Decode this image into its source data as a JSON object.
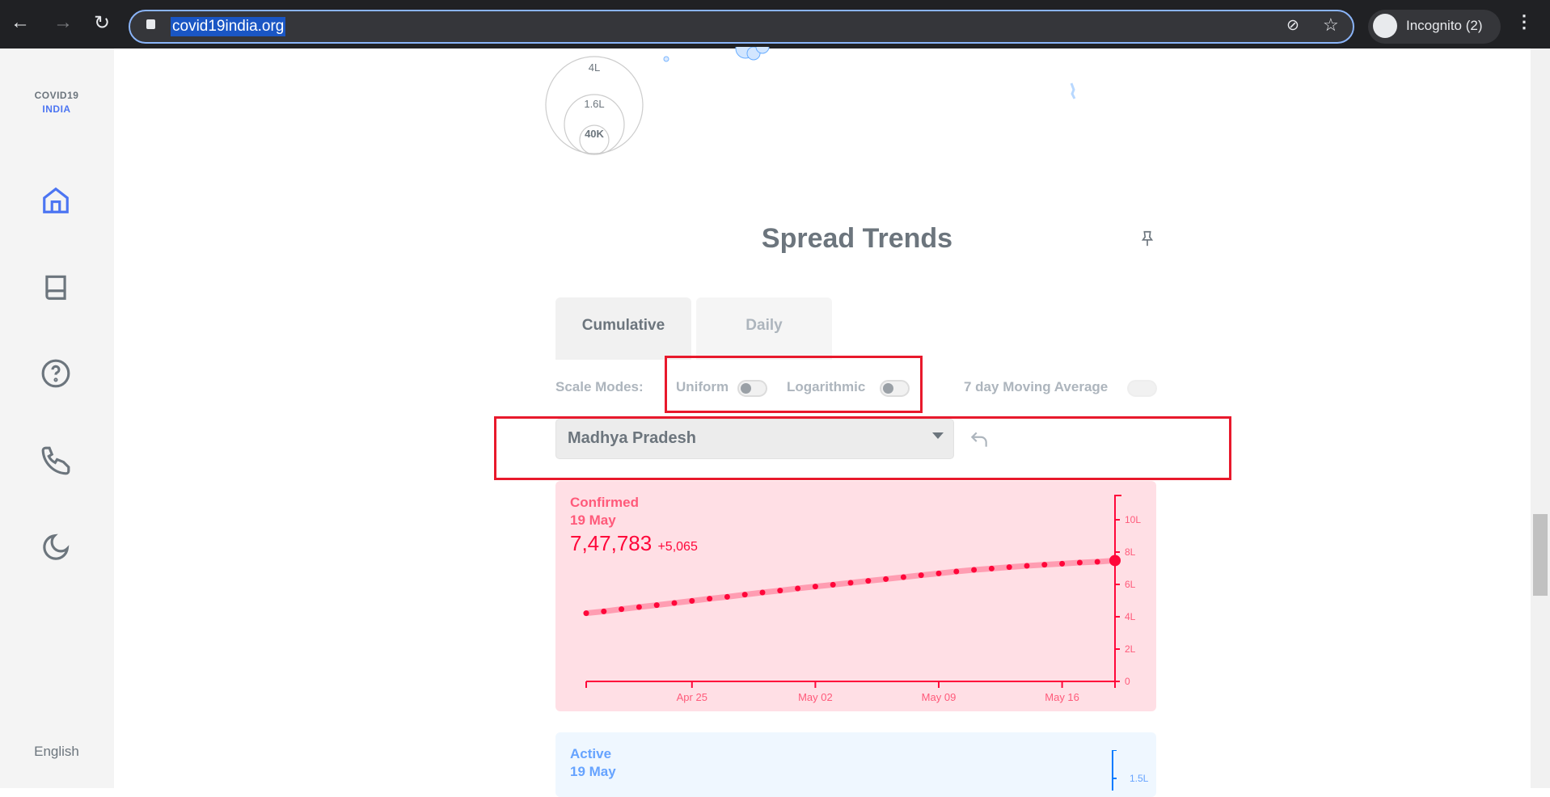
{
  "browser": {
    "url": "covid19india.org",
    "incognito_label": "Incognito (2)"
  },
  "sidebar": {
    "logo_line1": "COVID19",
    "logo_line2": "INDIA",
    "items": [
      {
        "icon": "home-icon"
      },
      {
        "icon": "book-icon"
      },
      {
        "icon": "help-icon"
      },
      {
        "icon": "phone-icon"
      },
      {
        "icon": "moon-icon"
      }
    ],
    "language": "English"
  },
  "map_legend": {
    "labels": [
      "4L",
      "1.6L",
      "40K"
    ]
  },
  "spread_trends": {
    "title": "Spread Trends",
    "tabs": [
      {
        "label": "Cumulative",
        "active": true
      },
      {
        "label": "Daily",
        "active": false
      }
    ],
    "scale_modes_label": "Scale Modes:",
    "toggles": [
      {
        "label": "Uniform",
        "on": false
      },
      {
        "label": "Logarithmic",
        "on": false
      },
      {
        "label": "7 day Moving Average",
        "on": false,
        "disabled": true
      }
    ],
    "region_select": "Madhya Pradesh",
    "confirmed": {
      "title": "Confirmed",
      "date": "19 May",
      "value": "7,47,783",
      "delta": "+5,065",
      "color": "#ff073a"
    },
    "active": {
      "title": "Active",
      "date": "19 May",
      "color": "#007bff",
      "tick": "1.5L"
    }
  },
  "chart_data": {
    "type": "line",
    "title": "Confirmed",
    "x": [
      "Apr 19",
      "Apr 20",
      "Apr 21",
      "Apr 22",
      "Apr 23",
      "Apr 24",
      "Apr 25",
      "Apr 26",
      "Apr 27",
      "Apr 28",
      "Apr 29",
      "Apr 30",
      "May 01",
      "May 02",
      "May 03",
      "May 04",
      "May 05",
      "May 06",
      "May 07",
      "May 08",
      "May 09",
      "May 10",
      "May 11",
      "May 12",
      "May 13",
      "May 14",
      "May 15",
      "May 16",
      "May 17",
      "May 18",
      "May 19"
    ],
    "series": [
      {
        "values": [
          4.22,
          4.33,
          4.47,
          4.6,
          4.72,
          4.85,
          4.98,
          5.12,
          5.23,
          5.37,
          5.5,
          5.62,
          5.75,
          5.87,
          5.98,
          6.1,
          6.22,
          6.33,
          6.45,
          6.57,
          6.68,
          6.8,
          6.9,
          6.98,
          7.07,
          7.15,
          7.22,
          7.28,
          7.35,
          7.4,
          7.47783
        ]
      }
    ],
    "y_unit": "lakh",
    "xticks": [
      "Apr 25",
      "May 02",
      "May 09",
      "May 16"
    ],
    "xtick_index": [
      6,
      13,
      20,
      27
    ],
    "yticks": [
      0,
      2,
      4,
      6,
      8,
      10
    ],
    "ytick_labels": [
      "0",
      "2L",
      "4L",
      "6L",
      "8L",
      "10L"
    ],
    "ylim": [
      0,
      11.5
    ],
    "axis_position": "right",
    "grid": false
  }
}
